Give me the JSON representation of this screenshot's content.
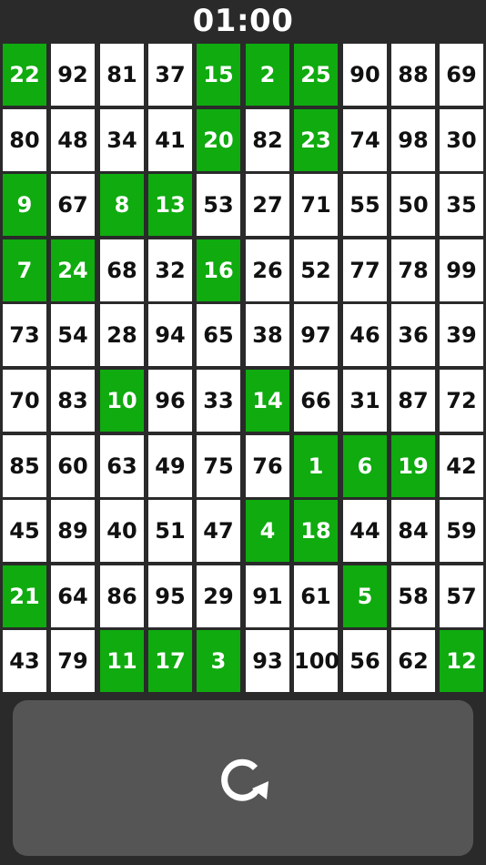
{
  "timer": "01:00",
  "colors": {
    "background": "#2a2a2a",
    "found": "#0fab0f",
    "unfound": "#ffffff",
    "panel": "#555555"
  },
  "grid": {
    "rows": [
      [
        {
          "n": "22",
          "found": true
        },
        {
          "n": "92",
          "found": false
        },
        {
          "n": "81",
          "found": false
        },
        {
          "n": "37",
          "found": false
        },
        {
          "n": "15",
          "found": true
        },
        {
          "n": "2",
          "found": true
        },
        {
          "n": "25",
          "found": true
        },
        {
          "n": "90",
          "found": false
        },
        {
          "n": "88",
          "found": false
        },
        {
          "n": "69",
          "found": false
        }
      ],
      [
        {
          "n": "80",
          "found": false
        },
        {
          "n": "48",
          "found": false
        },
        {
          "n": "34",
          "found": false
        },
        {
          "n": "41",
          "found": false
        },
        {
          "n": "20",
          "found": true
        },
        {
          "n": "82",
          "found": false
        },
        {
          "n": "23",
          "found": true
        },
        {
          "n": "74",
          "found": false
        },
        {
          "n": "98",
          "found": false
        },
        {
          "n": "30",
          "found": false
        }
      ],
      [
        {
          "n": "9",
          "found": true
        },
        {
          "n": "67",
          "found": false
        },
        {
          "n": "8",
          "found": true
        },
        {
          "n": "13",
          "found": true
        },
        {
          "n": "53",
          "found": false
        },
        {
          "n": "27",
          "found": false
        },
        {
          "n": "71",
          "found": false
        },
        {
          "n": "55",
          "found": false
        },
        {
          "n": "50",
          "found": false
        },
        {
          "n": "35",
          "found": false
        }
      ],
      [
        {
          "n": "7",
          "found": true
        },
        {
          "n": "24",
          "found": true
        },
        {
          "n": "68",
          "found": false
        },
        {
          "n": "32",
          "found": false
        },
        {
          "n": "16",
          "found": true
        },
        {
          "n": "26",
          "found": false
        },
        {
          "n": "52",
          "found": false
        },
        {
          "n": "77",
          "found": false
        },
        {
          "n": "78",
          "found": false
        },
        {
          "n": "99",
          "found": false
        }
      ],
      [
        {
          "n": "73",
          "found": false
        },
        {
          "n": "54",
          "found": false
        },
        {
          "n": "28",
          "found": false
        },
        {
          "n": "94",
          "found": false
        },
        {
          "n": "65",
          "found": false
        },
        {
          "n": "38",
          "found": false
        },
        {
          "n": "97",
          "found": false
        },
        {
          "n": "46",
          "found": false
        },
        {
          "n": "36",
          "found": false
        },
        {
          "n": "39",
          "found": false
        }
      ],
      [
        {
          "n": "70",
          "found": false
        },
        {
          "n": "83",
          "found": false
        },
        {
          "n": "10",
          "found": true
        },
        {
          "n": "96",
          "found": false
        },
        {
          "n": "33",
          "found": false
        },
        {
          "n": "14",
          "found": true
        },
        {
          "n": "66",
          "found": false
        },
        {
          "n": "31",
          "found": false
        },
        {
          "n": "87",
          "found": false
        },
        {
          "n": "72",
          "found": false
        }
      ],
      [
        {
          "n": "85",
          "found": false
        },
        {
          "n": "60",
          "found": false
        },
        {
          "n": "63",
          "found": false
        },
        {
          "n": "49",
          "found": false
        },
        {
          "n": "75",
          "found": false
        },
        {
          "n": "76",
          "found": false
        },
        {
          "n": "1",
          "found": true
        },
        {
          "n": "6",
          "found": true
        },
        {
          "n": "19",
          "found": true
        },
        {
          "n": "42",
          "found": false
        }
      ],
      [
        {
          "n": "45",
          "found": false
        },
        {
          "n": "89",
          "found": false
        },
        {
          "n": "40",
          "found": false
        },
        {
          "n": "51",
          "found": false
        },
        {
          "n": "47",
          "found": false
        },
        {
          "n": "4",
          "found": true
        },
        {
          "n": "18",
          "found": true
        },
        {
          "n": "44",
          "found": false
        },
        {
          "n": "84",
          "found": false
        },
        {
          "n": "59",
          "found": false
        }
      ],
      [
        {
          "n": "21",
          "found": true
        },
        {
          "n": "64",
          "found": false
        },
        {
          "n": "86",
          "found": false
        },
        {
          "n": "95",
          "found": false
        },
        {
          "n": "29",
          "found": false
        },
        {
          "n": "91",
          "found": false
        },
        {
          "n": "61",
          "found": false
        },
        {
          "n": "5",
          "found": true
        },
        {
          "n": "58",
          "found": false
        },
        {
          "n": "57",
          "found": false
        }
      ],
      [
        {
          "n": "43",
          "found": false
        },
        {
          "n": "79",
          "found": false
        },
        {
          "n": "11",
          "found": true
        },
        {
          "n": "17",
          "found": true
        },
        {
          "n": "3",
          "found": true
        },
        {
          "n": "93",
          "found": false
        },
        {
          "n": "100",
          "found": false
        },
        {
          "n": "56",
          "found": false
        },
        {
          "n": "62",
          "found": false
        },
        {
          "n": "12",
          "found": true
        }
      ]
    ]
  },
  "reset": {
    "icon": "refresh-icon"
  }
}
